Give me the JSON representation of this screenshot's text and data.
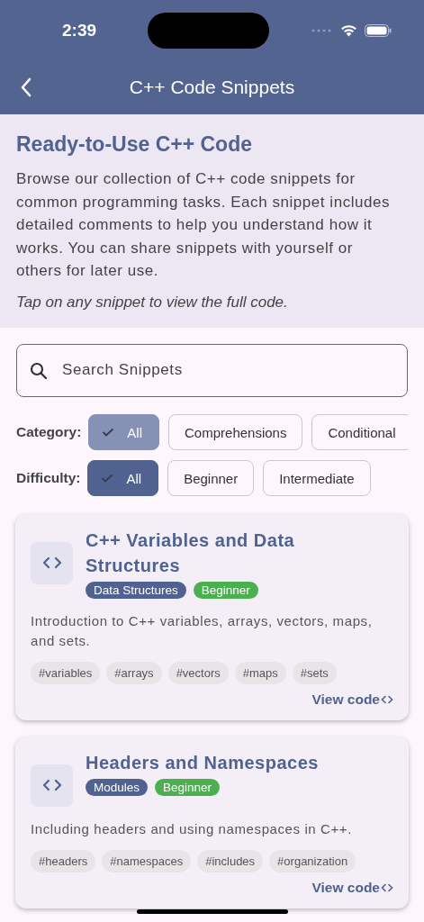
{
  "status_bar": {
    "time": "2:39"
  },
  "nav_bar": {
    "title": "C++ Code Snippets"
  },
  "intro": {
    "heading": "Ready-to-Use C++ Code",
    "body": "Browse our collection of C++ code snippets for common programming tasks. Each snippet includes detailed comments to help you understand how it works. You can share snippets with yourself or others for later use.",
    "hint": "Tap on any snippet to view the full code."
  },
  "search": {
    "placeholder": "Search Snippets"
  },
  "filters": [
    {
      "label": "Category:",
      "kind": "muted",
      "chips": [
        {
          "label": "All",
          "selected": true
        },
        {
          "label": "Comprehensions",
          "selected": false
        },
        {
          "label": "Conditional",
          "selected": false
        }
      ]
    },
    {
      "label": "Difficulty:",
      "kind": "strong",
      "chips": [
        {
          "label": "All",
          "selected": true
        },
        {
          "label": "Beginner",
          "selected": false
        },
        {
          "label": "Intermediate",
          "selected": false
        }
      ]
    }
  ],
  "snippets": [
    {
      "title": "C++ Variables and Data Structures",
      "tags": [
        {
          "label": "Data Structures",
          "color": "#50628f"
        },
        {
          "label": "Beginner",
          "color": "#4caf50"
        }
      ],
      "description": "Introduction to C++ variables, arrays, vectors, maps, and sets.",
      "hashtags": [
        "#variables",
        "#arrays",
        "#vectors",
        "#maps",
        "#sets"
      ],
      "action": "View code"
    },
    {
      "title": "Headers and Namespaces",
      "tags": [
        {
          "label": "Modules",
          "color": "#50628f"
        },
        {
          "label": "Beginner",
          "color": "#4caf50"
        }
      ],
      "description": "Including headers and using namespaces in C++.",
      "hashtags": [
        "#headers",
        "#namespaces",
        "#includes",
        "#organization"
      ],
      "action": "View code"
    }
  ]
}
